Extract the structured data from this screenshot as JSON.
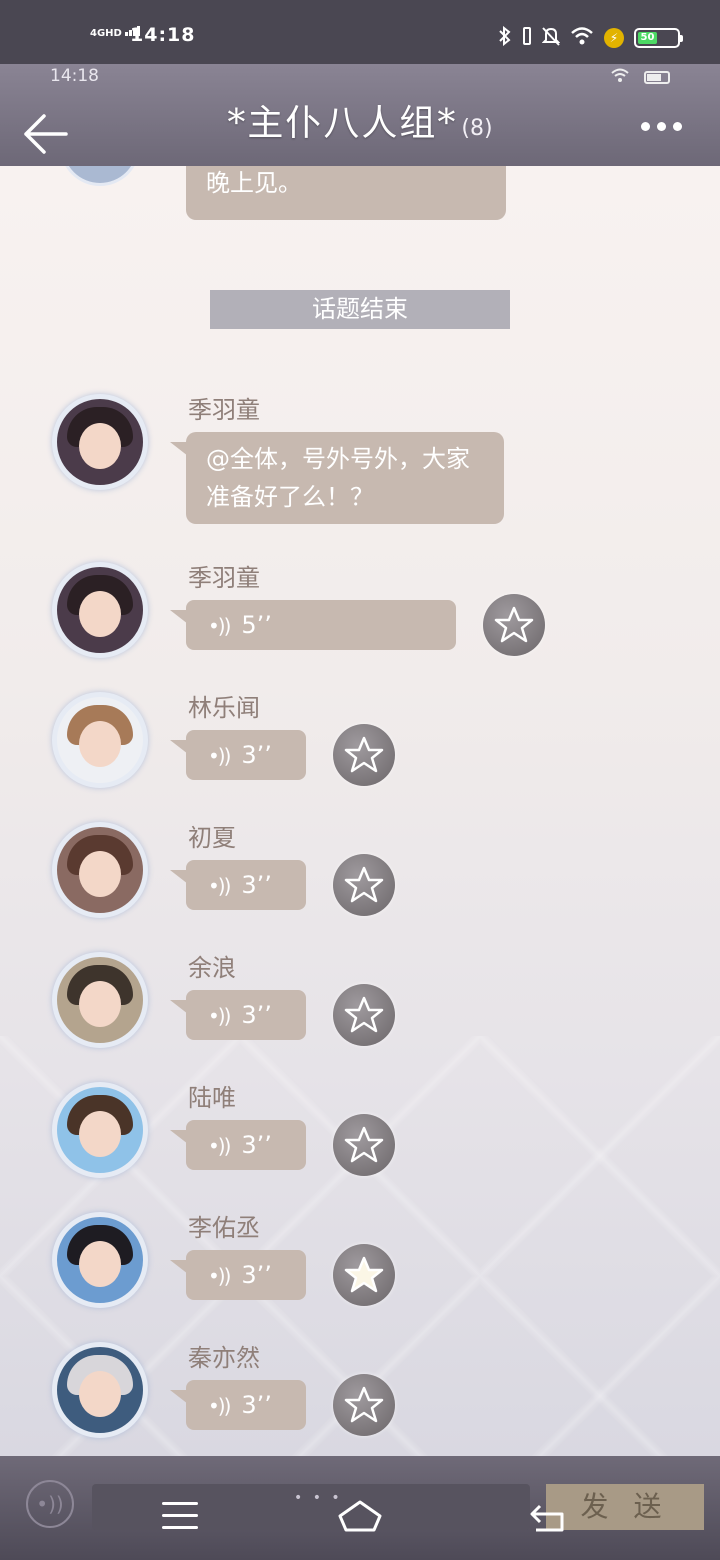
{
  "status_bar": {
    "network": "4GHD",
    "time": "14:18",
    "battery": "50",
    "icons": [
      "bluetooth-icon",
      "vibrate-icon",
      "mute-icon",
      "wifi-icon",
      "charging-icon",
      "battery-icon"
    ]
  },
  "header": {
    "ingame_time": "14:18",
    "title": "*主仆八人组*",
    "member_count": "(8)"
  },
  "chat": {
    "previous_message_tail": "晚上见。",
    "divider": "话题结束",
    "messages": [
      {
        "sender": "季羽童",
        "type": "text",
        "text": "@全体，号外号外，大家准备好了么！？"
      },
      {
        "sender": "季羽童",
        "type": "voice",
        "duration": "5’’",
        "starred": false
      },
      {
        "sender": "林乐闻",
        "type": "voice",
        "duration": "3’’",
        "starred": false
      },
      {
        "sender": "初夏",
        "type": "voice",
        "duration": "3’’",
        "starred": false
      },
      {
        "sender": "余浪",
        "type": "voice",
        "duration": "3’’",
        "starred": false
      },
      {
        "sender": "陆唯",
        "type": "voice",
        "duration": "3’’",
        "starred": false
      },
      {
        "sender": "李佑丞",
        "type": "voice",
        "duration": "3’’",
        "starred": true
      },
      {
        "sender": "秦亦然",
        "type": "voice",
        "duration": "3’’",
        "starred": false
      }
    ]
  },
  "input_bar": {
    "send_label": "发 送"
  },
  "colors": {
    "bubble": "#c7b9b0",
    "header": "#7b7685",
    "sender_name": "#8f7f79",
    "divider": "#b2b0b8"
  }
}
